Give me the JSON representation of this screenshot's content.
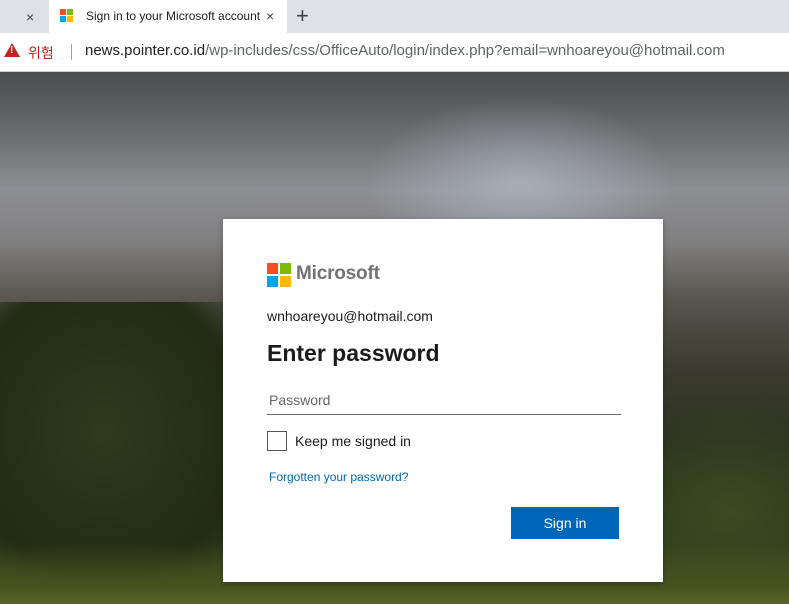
{
  "browser": {
    "tabs": [
      {
        "title": "",
        "active": false
      },
      {
        "title": "Sign in to your Microsoft account",
        "active": true,
        "favicon": "microsoft-logo"
      }
    ],
    "close_glyph": "×",
    "new_tab_glyph": "+",
    "security_label": "위험",
    "security_icon": "warning-triangle-icon",
    "url_host": "news.pointer.co.id",
    "url_path": "/wp-includes/css/OfficeAuto/login/index.php?email=wnhoareyou@hotmail.com"
  },
  "signin": {
    "brand": "Microsoft",
    "email": "wnhoareyou@hotmail.com",
    "heading": "Enter password",
    "password_placeholder": "Password",
    "password_value": "",
    "keep_signed_in_label": "Keep me signed in",
    "keep_signed_in_checked": false,
    "forgot_link": "Forgotten your password?",
    "submit_label": "Sign in"
  },
  "colors": {
    "ms_red": "#f25022",
    "ms_green": "#7fba00",
    "ms_blue": "#00a4ef",
    "ms_yellow": "#ffb900",
    "accent": "#0067b8",
    "danger": "#c5221f"
  }
}
